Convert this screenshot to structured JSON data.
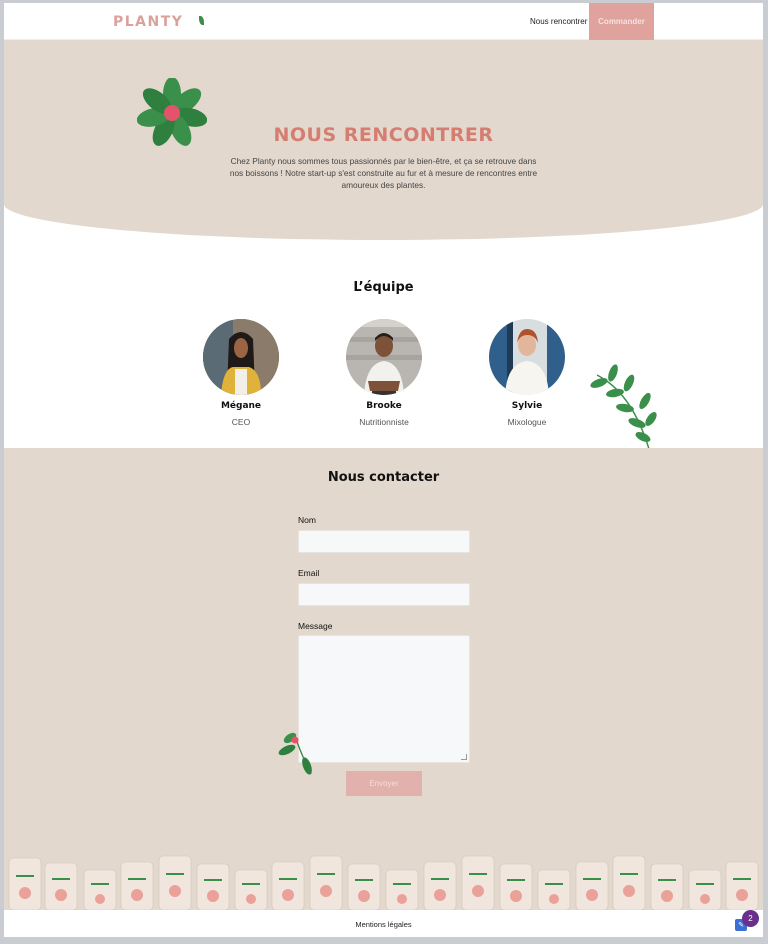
{
  "header": {
    "logo": "PLANTY",
    "nav_link": "Nous rencontrer",
    "order_button": "Commander"
  },
  "hero": {
    "title": "NOUS RENCONTRER",
    "text": "Chez Planty nous sommes tous passionnés par le bien-être, et ça se retrouve dans nos boissons ! Notre start-up s'est construite au fur et à mesure de rencontres entre amoureux des plantes."
  },
  "team": {
    "title": "L’équipe",
    "members": [
      {
        "name": "Mégane",
        "role": "CEO"
      },
      {
        "name": "Brooke",
        "role": "Nutritionniste"
      },
      {
        "name": "Sylvie",
        "role": "Mixologue"
      }
    ]
  },
  "contact": {
    "title": "Nous contacter",
    "name_label": "Nom",
    "name_value": "",
    "email_label": "Email",
    "email_value": "",
    "message_label": "Message",
    "message_value": "",
    "submit_label": "Envoyer"
  },
  "footer": {
    "link": "Mentions légales",
    "badge_count": "2"
  },
  "colors": {
    "brand_pink": "#e0a29c",
    "title_coral": "#d57d70",
    "beige": "#e3d8cd",
    "leaf_green": "#3a8f4a"
  }
}
